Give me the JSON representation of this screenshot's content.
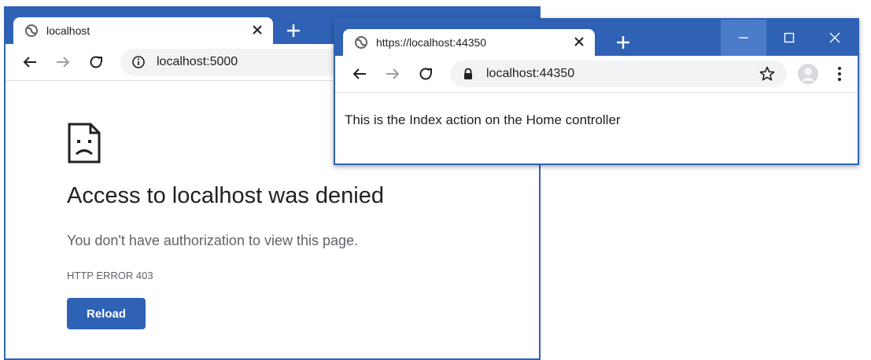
{
  "window_back": {
    "tab": {
      "icon": "globe-icon",
      "title": "localhost",
      "close": "close-icon"
    },
    "new_tab": "plus-icon",
    "toolbar": {
      "back": "arrow-left-icon",
      "forward": "arrow-right-icon",
      "reload": "reload-icon",
      "site_info": "info-icon",
      "url": "localhost:5000"
    },
    "error_page": {
      "icon": "sad-document-icon",
      "title": "Access to localhost was denied",
      "message": "You don't have authorization to view this page.",
      "code": "HTTP ERROR 403",
      "reload_label": "Reload"
    }
  },
  "window_front": {
    "tab": {
      "icon": "globe-icon",
      "title": "https://localhost:44350",
      "close": "close-icon"
    },
    "new_tab": "plus-icon",
    "window_controls": [
      "minimize-icon",
      "maximize-icon",
      "close-icon"
    ],
    "toolbar": {
      "back": "arrow-left-icon",
      "forward": "arrow-right-icon",
      "reload": "reload-icon",
      "secure": "lock-icon",
      "url": "localhost:44350",
      "bookmark": "star-icon",
      "profile": "avatar-icon",
      "menu": "kebab-menu-icon"
    },
    "content": {
      "text": "This is the Index action on the Home controller"
    }
  },
  "colors": {
    "frame_blue": "#2f62b5",
    "button_blue": "#2f62b5",
    "omnibox_gray": "#f1f3f4",
    "text_dark": "#202124",
    "text_gray": "#5f6368"
  }
}
